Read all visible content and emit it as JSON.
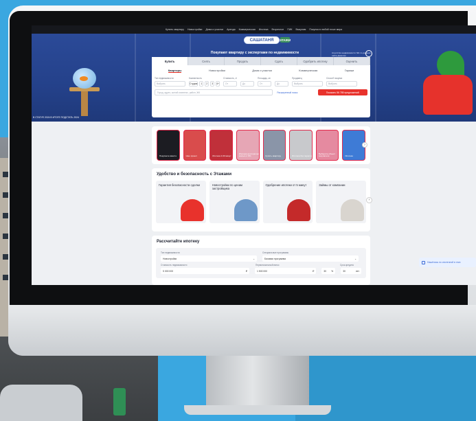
{
  "topnav": {
    "items": [
      "Купить квартиру",
      "Новостройки",
      "Дома и участки",
      "Аренда",
      "Коммерческая",
      "Ипотека",
      "Вторичное",
      "ПИК",
      "Выкупим",
      "Покупка в любой точке мира"
    ]
  },
  "hero": {
    "logo": "САШАТАНЯ",
    "logo_badge": "ЭТАЖИ",
    "title": "Покупают квартиру с экспертами по недвижимости",
    "note": "Агентство недвижимости №1 по данным сайта Домклик",
    "caption": "В СТАТУЕ 2024 В ИТОГЕ ПОДСТАТЬ 2024"
  },
  "search": {
    "deal_tabs": [
      "Купить",
      "Снять",
      "Продать",
      "Сдать",
      "Одобрить ипотеку",
      "Оценить"
    ],
    "type_tabs": [
      "Квартиры",
      "Новостройки",
      "Дома и участки",
      "Коммерческая",
      "Гаражи"
    ],
    "filter_labels": [
      "Тип недвижимости",
      "Комнатность",
      "Стоимость, ₽",
      "Площадь, м²",
      "Продавец",
      "Способ покупки"
    ],
    "property_type_value": "Выбрать",
    "rooms": [
      "Студия",
      "1",
      "2",
      "3",
      "4+"
    ],
    "price_from": "От",
    "price_to": "До",
    "area_from": "От",
    "area_to": "До",
    "seller_value": "Выбрать",
    "purchase_value": "Выбрать",
    "address_placeholder": "Город, адрес, жилой комплекс, район, ЖК",
    "advanced_link": "Расширенный поиск",
    "show_button": "Показать 56 785 предложений"
  },
  "stories": [
    {
      "text": "Покупаете вместе",
      "color": "#1c1c22"
    },
    {
      "text": "Наш проект",
      "color": "#d94c4c"
    },
    {
      "text": "Ипотека 4-60 минут",
      "color": "#c0303a"
    },
    {
      "text": "Ипотека на вторичное жильё от 8%",
      "color": "#e6a6b5"
    },
    {
      "text": "Купить квартиру",
      "color": "#8a95a8"
    },
    {
      "text": "Ипотека без переплат",
      "color": "#c8c9cc"
    },
    {
      "text": "Выберите объект покупателя",
      "color": "#e58aa0"
    },
    {
      "text": "Ипотека",
      "color": "#3e7bd6"
    }
  ],
  "features": {
    "title": "Удобство и безопасность с Этажами",
    "cards": [
      {
        "label": "Гарантия безопасности сделки",
        "color": "#e8322c"
      },
      {
        "label": "Новостройки по ценам застройщика",
        "color": "#6e98c8"
      },
      {
        "label": "Одобрение ипотеки от 5 минут",
        "color": "#c42a2a"
      },
      {
        "label": "Займы от компании",
        "color": "#d9d5cf"
      }
    ]
  },
  "mortgage": {
    "title": "Рассчитайте ипотеку",
    "labels_row1": [
      "Тип недвижимости",
      "Специальные программы"
    ],
    "type_value": "Новостройки",
    "program_value": "Базовая программа",
    "labels_row2": [
      "Стоимость недвижимости",
      "Первоначальный взнос",
      "Срок кредита"
    ],
    "price_value": "5 000 000",
    "down_value": "1 500 000",
    "down_percent": "30",
    "term_value": "30",
    "currency": "₽",
    "percent_sign": "%",
    "years": "лет"
  },
  "side_chip": "Нашёлись по ипотечной в этих"
}
